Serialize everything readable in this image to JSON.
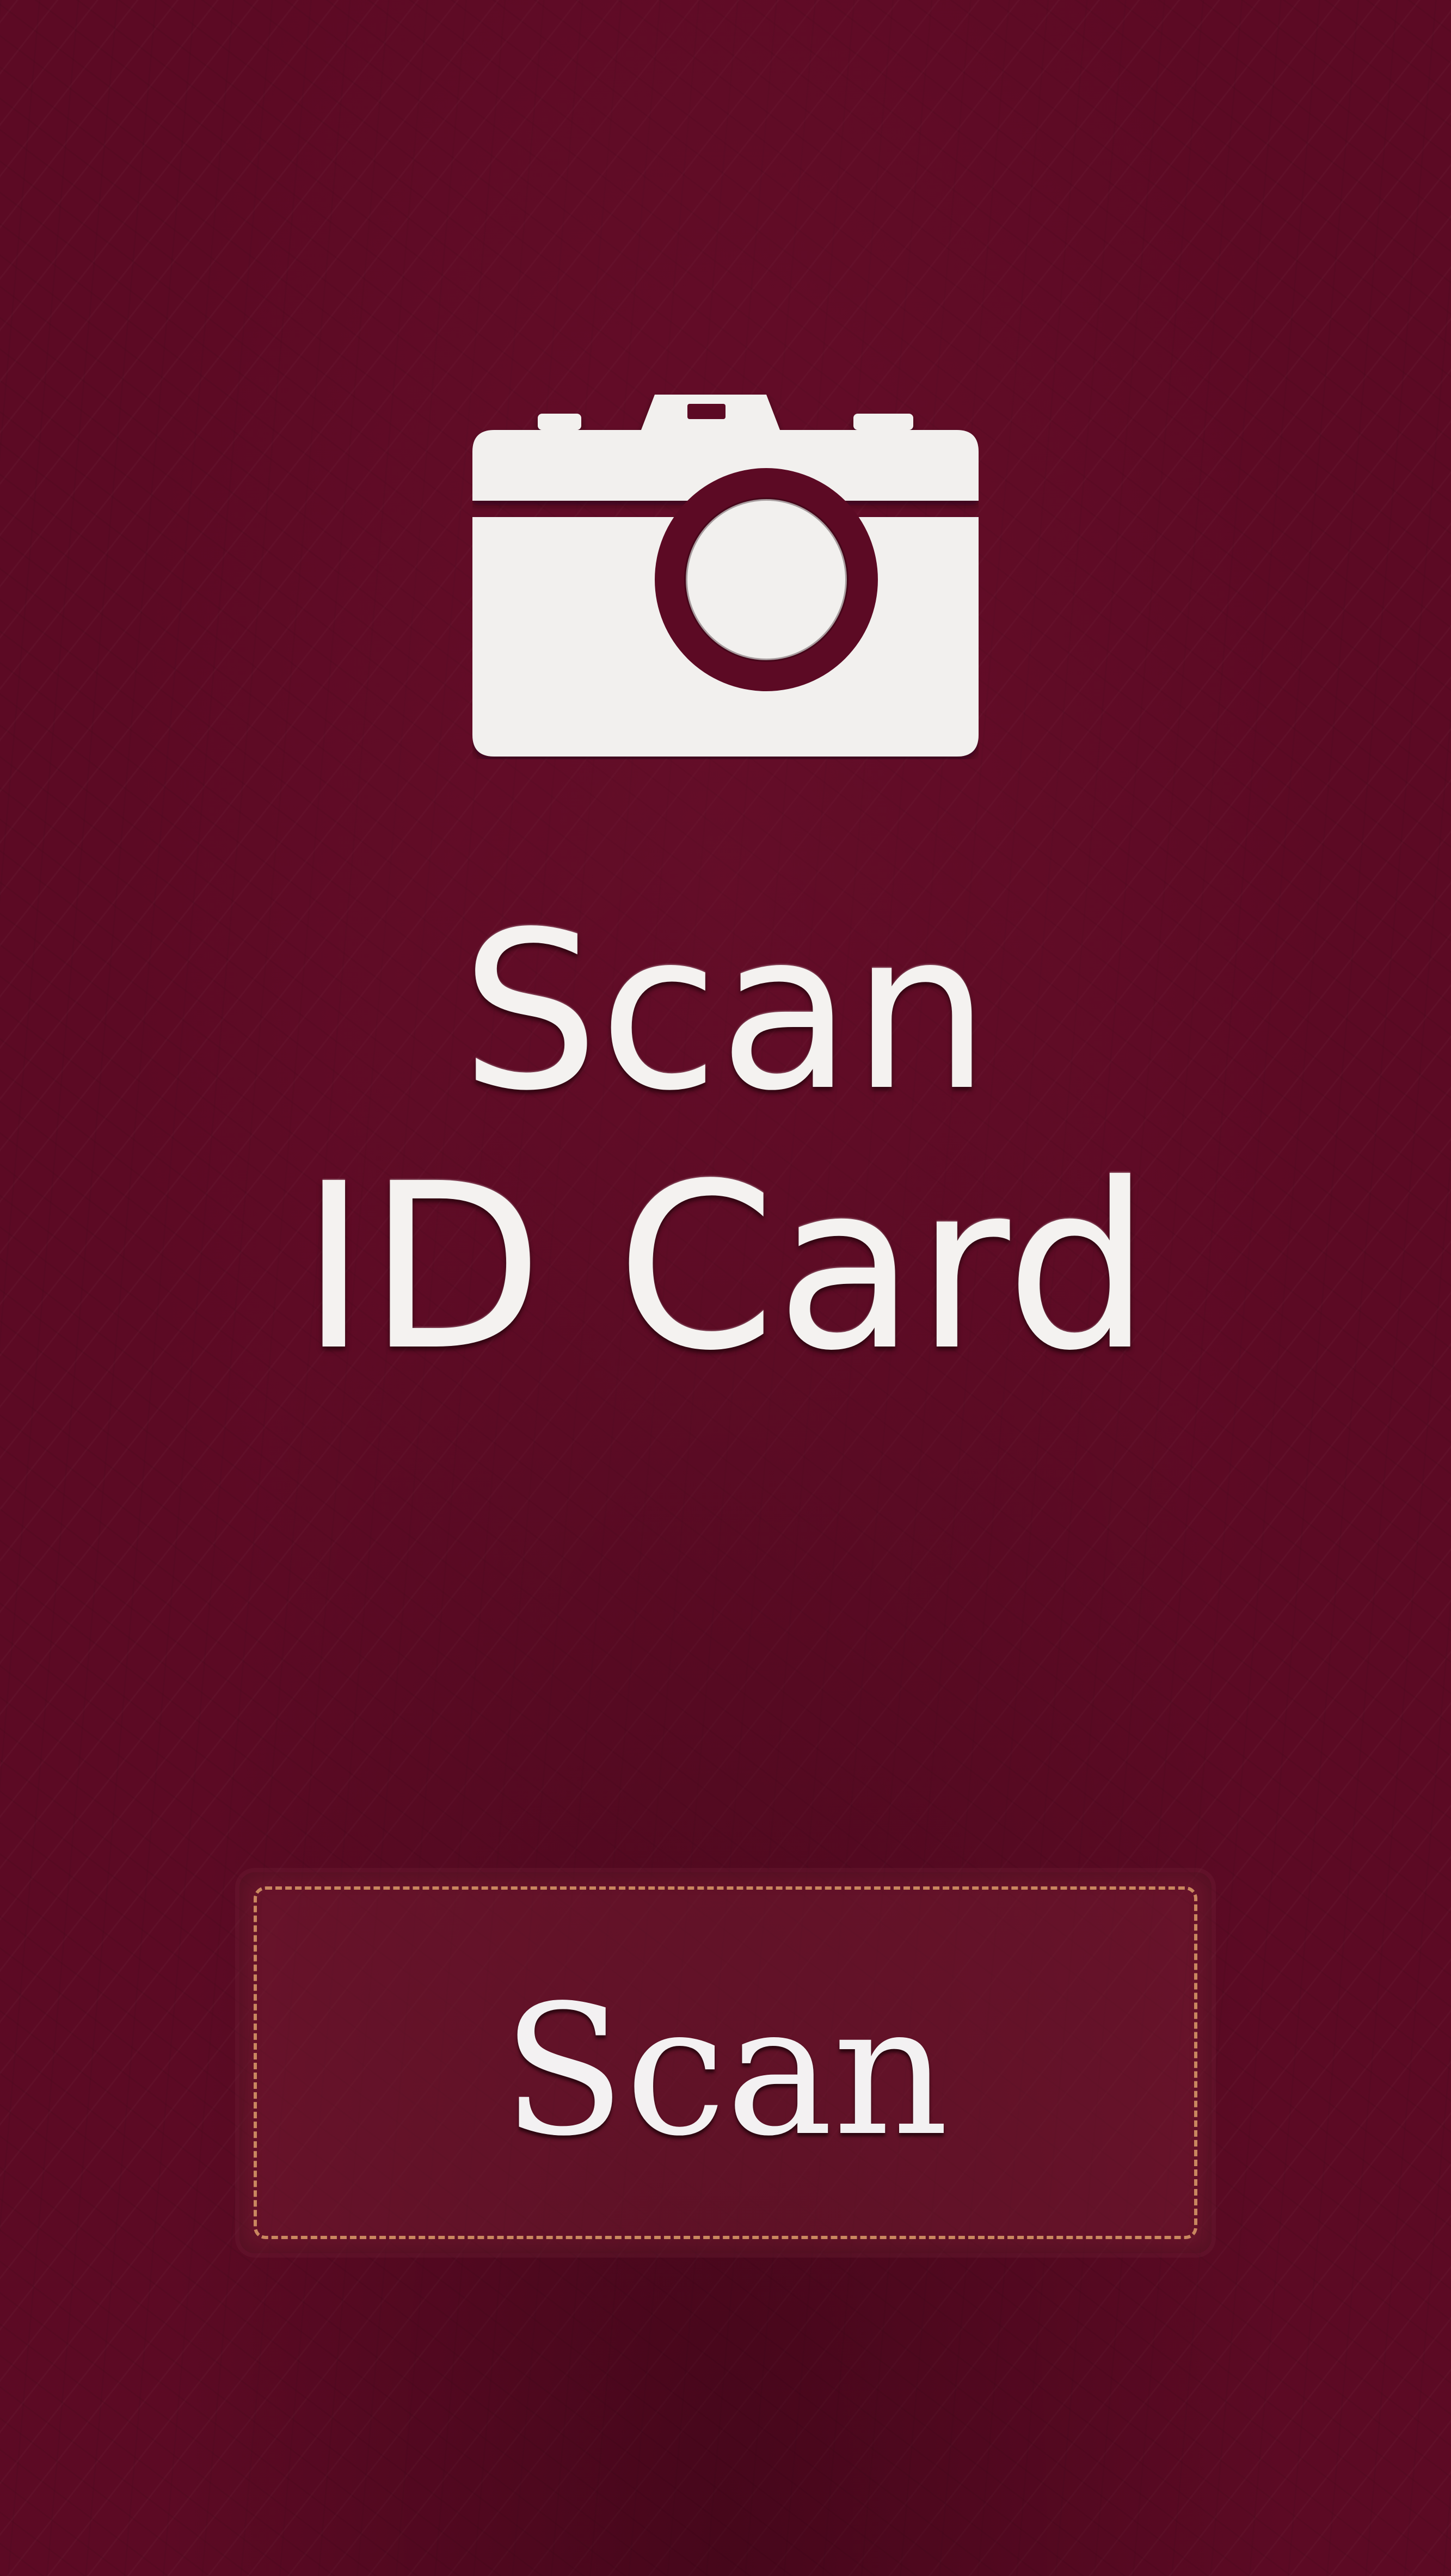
{
  "screen": {
    "background_color": "#5c0a24",
    "text_color": "#f4f2f0",
    "stitch_color": "#c9875f"
  },
  "hero": {
    "icon": "camera-icon",
    "title_line_1": "Scan",
    "title_line_2": "ID Card"
  },
  "actions": {
    "scan_label": "Scan"
  }
}
